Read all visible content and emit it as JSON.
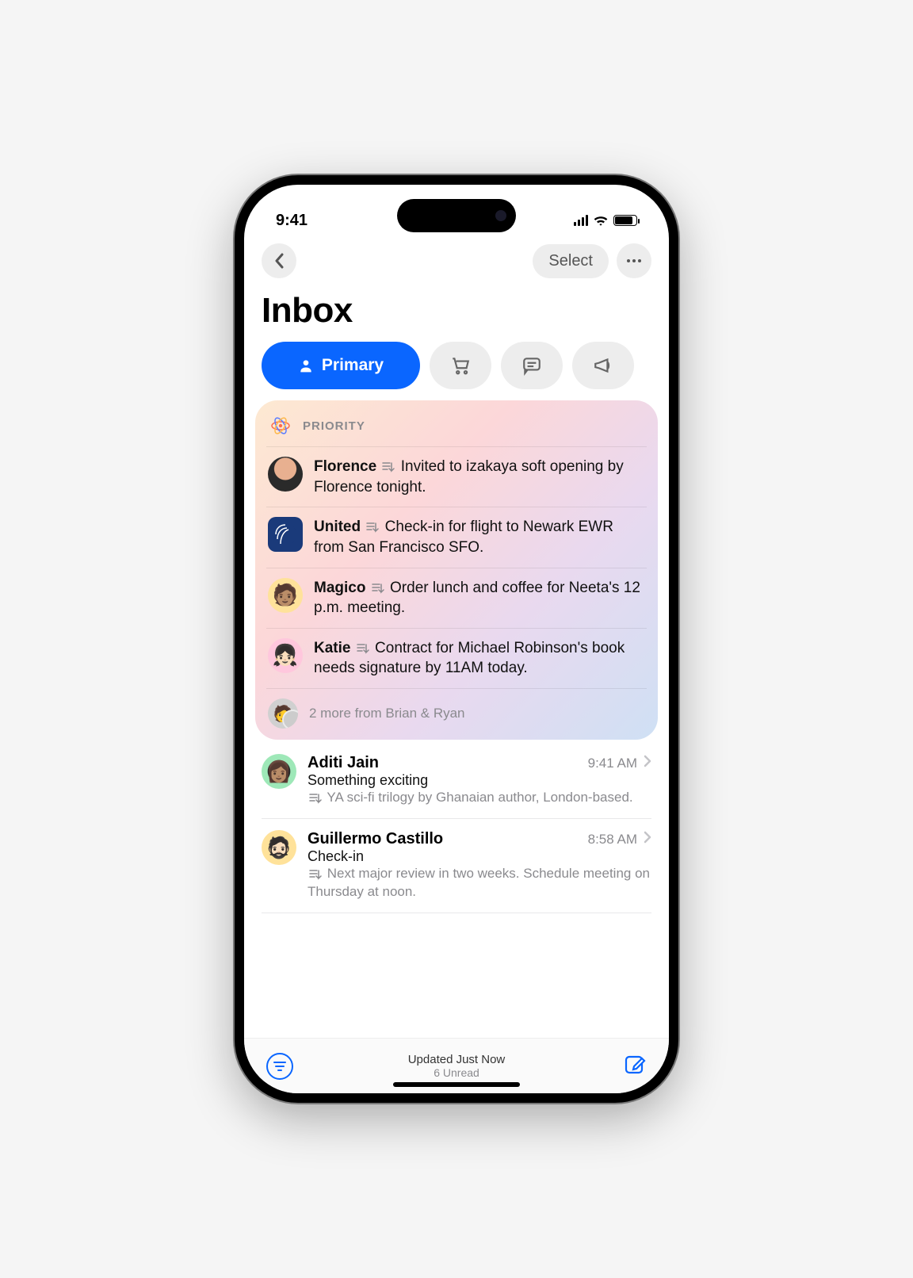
{
  "status": {
    "time": "9:41"
  },
  "nav": {
    "select_label": "Select"
  },
  "title": "Inbox",
  "tabs": {
    "primary_label": "Primary",
    "cart_name": "shopping",
    "chat_name": "updates",
    "promo_name": "promotions"
  },
  "priority": {
    "heading": "PRIORITY",
    "items": [
      {
        "sender": "Florence",
        "summary": "Invited to izakaya soft opening by Florence tonight."
      },
      {
        "sender": "United",
        "summary": "Check-in for flight to Newark EWR from San Francisco SFO."
      },
      {
        "sender": "Magico",
        "summary": "Order lunch and coffee for Neeta's 12 p.m. meeting."
      },
      {
        "sender": "Katie",
        "summary": "Contract for Michael Robinson's book needs signature by 11AM today."
      }
    ],
    "more_text": "2 more from Brian & Ryan"
  },
  "messages": [
    {
      "from": "Aditi Jain",
      "time": "9:41 AM",
      "subject": "Something exciting",
      "preview": "YA sci-fi trilogy by Ghanaian author, London-based."
    },
    {
      "from": "Guillermo Castillo",
      "time": "8:58 AM",
      "subject": "Check-in",
      "preview": "Next major review in two weeks. Schedule meeting on Thursday at noon."
    }
  ],
  "footer": {
    "status_line": "Updated Just Now",
    "unread_line": "6 Unread"
  }
}
